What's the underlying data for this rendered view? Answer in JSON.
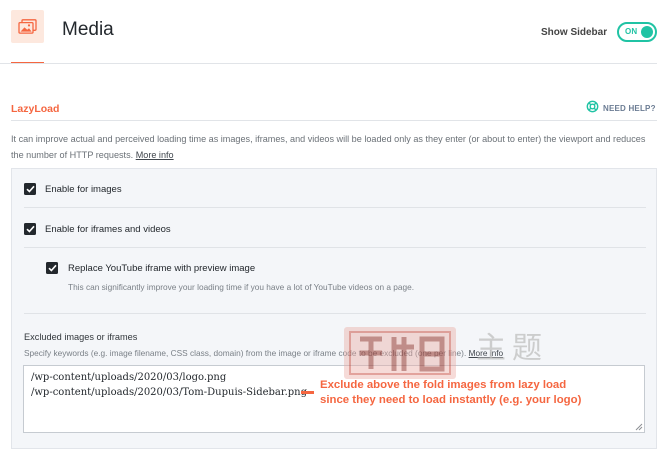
{
  "header": {
    "title": "Media",
    "icon": "media-images-icon",
    "sidebar_toggle": {
      "label": "Show Sidebar",
      "state": "ON"
    }
  },
  "section": {
    "title": "LazyLoad",
    "help_label": "NEED HELP?",
    "help_icon": "lifebuoy-icon",
    "description": "It can improve actual and perceived loading time as images, iframes, and videos will be loaded only as they enter (or about to enter) the viewport and reduces the number of HTTP requests.",
    "more_info": "More info"
  },
  "options": {
    "images": {
      "label": "Enable for images",
      "checked": true
    },
    "iframes": {
      "label": "Enable for iframes and videos",
      "checked": true
    },
    "youtube": {
      "label": "Replace YouTube iframe with preview image",
      "description": "This can significantly improve your loading time if you have a lot of YouTube videos on a page.",
      "checked": true
    }
  },
  "excluded": {
    "title": "Excluded images or iframes",
    "description": "Specify keywords (e.g. image filename, CSS class, domain) from the image or iframe code to be excluded (one per line).",
    "more_info": "More info",
    "value": "/wp-content/uploads/2020/03/logo.png\n/wp-content/uploads/2020/03/Tom-Dupuis-Sidebar.png"
  },
  "annotation": {
    "line1": "Exclude above the fold images from lazy load",
    "line2": "since they need to load instantly (e.g. your logo)"
  },
  "watermark": {
    "text": "主题"
  },
  "colors": {
    "accent": "#f56640",
    "toggle": "#20c3a4",
    "panel_bg": "#f4f6f9",
    "checkbox": "#23282d"
  }
}
